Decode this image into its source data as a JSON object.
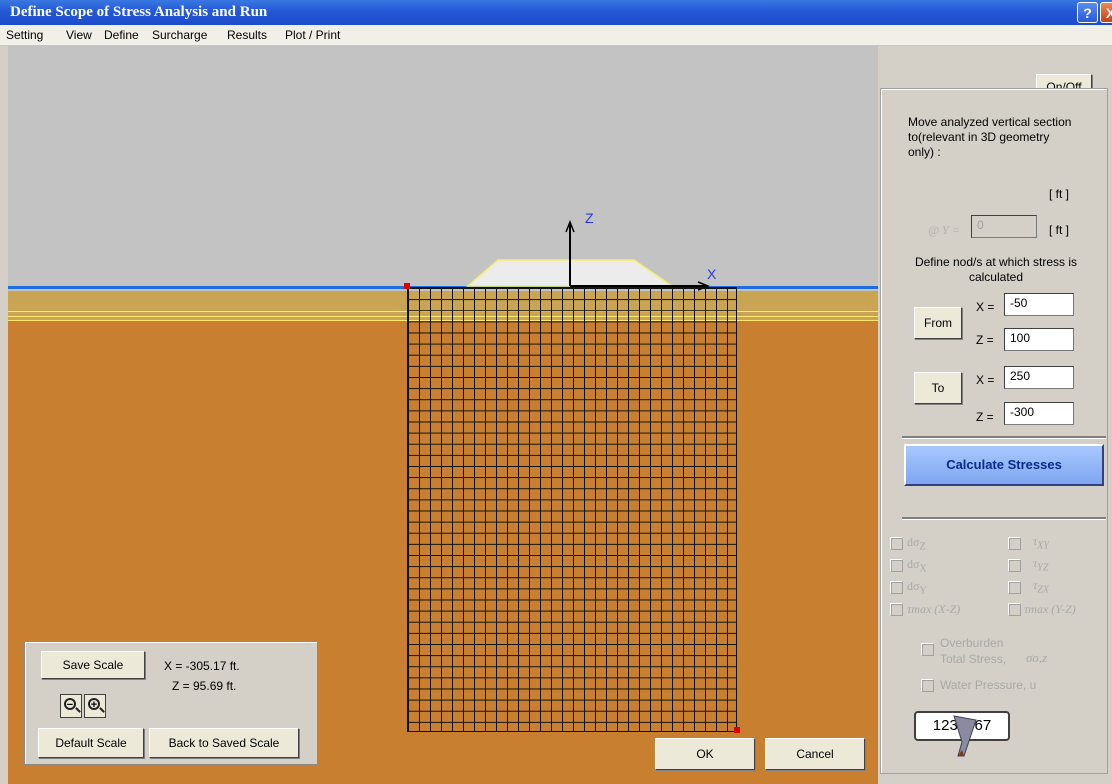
{
  "window": {
    "title": "Define Scope of Stress Analysis and Run",
    "help_label": "?",
    "close_label": "X"
  },
  "menu": {
    "items": [
      "Setting",
      "View",
      "Define",
      "Surcharge",
      "Results",
      "Plot / Print"
    ]
  },
  "canvas": {
    "axis_z": "Z",
    "axis_x": "X",
    "colors": {
      "background": "#c3c3c3",
      "soil_lower": "#c88030",
      "soil_upper": "#c9a453",
      "water_line": "#1d6fe0",
      "node": "#e00000"
    }
  },
  "scale_panel": {
    "save_scale": "Save Scale",
    "default_scale": "Default Scale",
    "back_to_saved": "Back to Saved Scale",
    "x_readout": "X = -305.17 ft.",
    "z_readout": "Z = 95.69 ft."
  },
  "dialog_buttons": {
    "ok": "OK",
    "cancel": "Cancel"
  },
  "right_panel": {
    "on_off": "On/Off",
    "move_text": "Move analyzed vertical section to(relevant in 3D geometry only) :",
    "unit_ft": "[ ft ]",
    "y_label": "@ Y =",
    "y_value": "0",
    "define_text": "Define nod/s at which stress is calculated",
    "from_label": "From",
    "to_label": "To",
    "x_eq": "X =",
    "z_eq": "Z =",
    "from_x": "-50",
    "from_z": "100",
    "to_x": "250",
    "to_z": "-300",
    "calculate": "Calculate  Stresses",
    "checkboxes": {
      "d_sigma_z": "dσ",
      "d_sigma_x": "dσ",
      "d_sigma_y": "dσ",
      "tau_max_xz": "τmax  (X-Z)",
      "tau_xy": "τ",
      "tau_yz": "τ",
      "tau_zx": "τ",
      "tau_max_yz": "τmax (Y-Z)"
    },
    "sub_z": "Z",
    "sub_x": "X",
    "sub_y": "Y",
    "sub_xy": "XY",
    "sub_yz": "YZ",
    "sub_zx": "ZX",
    "overburden_1": "Overburden",
    "overburden_2": "Total Stress,",
    "sigma_oz": "σo,z",
    "water_pressure": "Water Pressure, u",
    "digits": "1234567"
  }
}
